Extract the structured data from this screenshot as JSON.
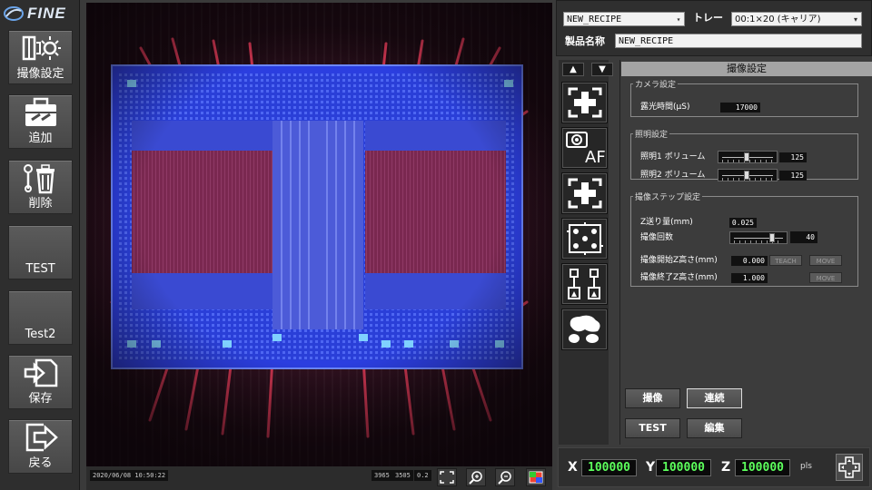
{
  "brand": {
    "name": "FINE"
  },
  "sidebar": {
    "items": [
      {
        "label": "撮像設定",
        "icon": "camera-light-icon"
      },
      {
        "label": "追加",
        "icon": "toolbox-add-icon"
      },
      {
        "label": "削除",
        "icon": "trash-tools-icon"
      },
      {
        "label": "TEST",
        "icon": ""
      },
      {
        "label": "Test2",
        "icon": ""
      },
      {
        "label": "保存",
        "icon": "save-icon"
      },
      {
        "label": "戻る",
        "icon": "exit-icon"
      }
    ]
  },
  "status_bar": {
    "timestamp": "2020/06/08 10:50:22",
    "width_px": "3965",
    "height_px": "3505",
    "zoom": "0.2"
  },
  "recipe": {
    "recipe_name": "NEW_RECIPE",
    "tray_label": "トレー",
    "tray_value": "00:1×20 (キャリア)",
    "product_label": "製品名称",
    "product_value": "NEW_RECIPE"
  },
  "tools": {
    "up": "▲",
    "down": "▼",
    "af_label": "AF"
  },
  "settings": {
    "header": "撮像設定",
    "camera": {
      "title": "カメラ設定",
      "exposure_label": "露光時間(μS)",
      "exposure_value": "17000"
    },
    "lighting": {
      "title": "照明設定",
      "light1_label": "照明1 ボリューム",
      "light1_value": "125",
      "light2_label": "照明2 ボリューム",
      "light2_value": "125"
    },
    "step": {
      "title": "撮像ステップ設定",
      "zfeed_label": "Z送り量(mm)",
      "zfeed_value": "0.025",
      "count_label": "撮像回数",
      "count_value": "40",
      "zstart_label": "撮像開始Z高さ(mm)",
      "zstart_value": "0.000",
      "zend_label": "撮像終了Z高さ(mm)",
      "zend_value": "1.000",
      "teach_label": "TEACH",
      "move_label": "MOVE"
    },
    "buttons": {
      "capture": "撮像",
      "continuous": "連続",
      "test": "TEST",
      "edit": "編集"
    }
  },
  "coords": {
    "x_label": "X",
    "x_value": "100000",
    "y_label": "Y",
    "y_value": "100000",
    "z_label": "Z",
    "z_value": "100000",
    "unit": "pls"
  }
}
